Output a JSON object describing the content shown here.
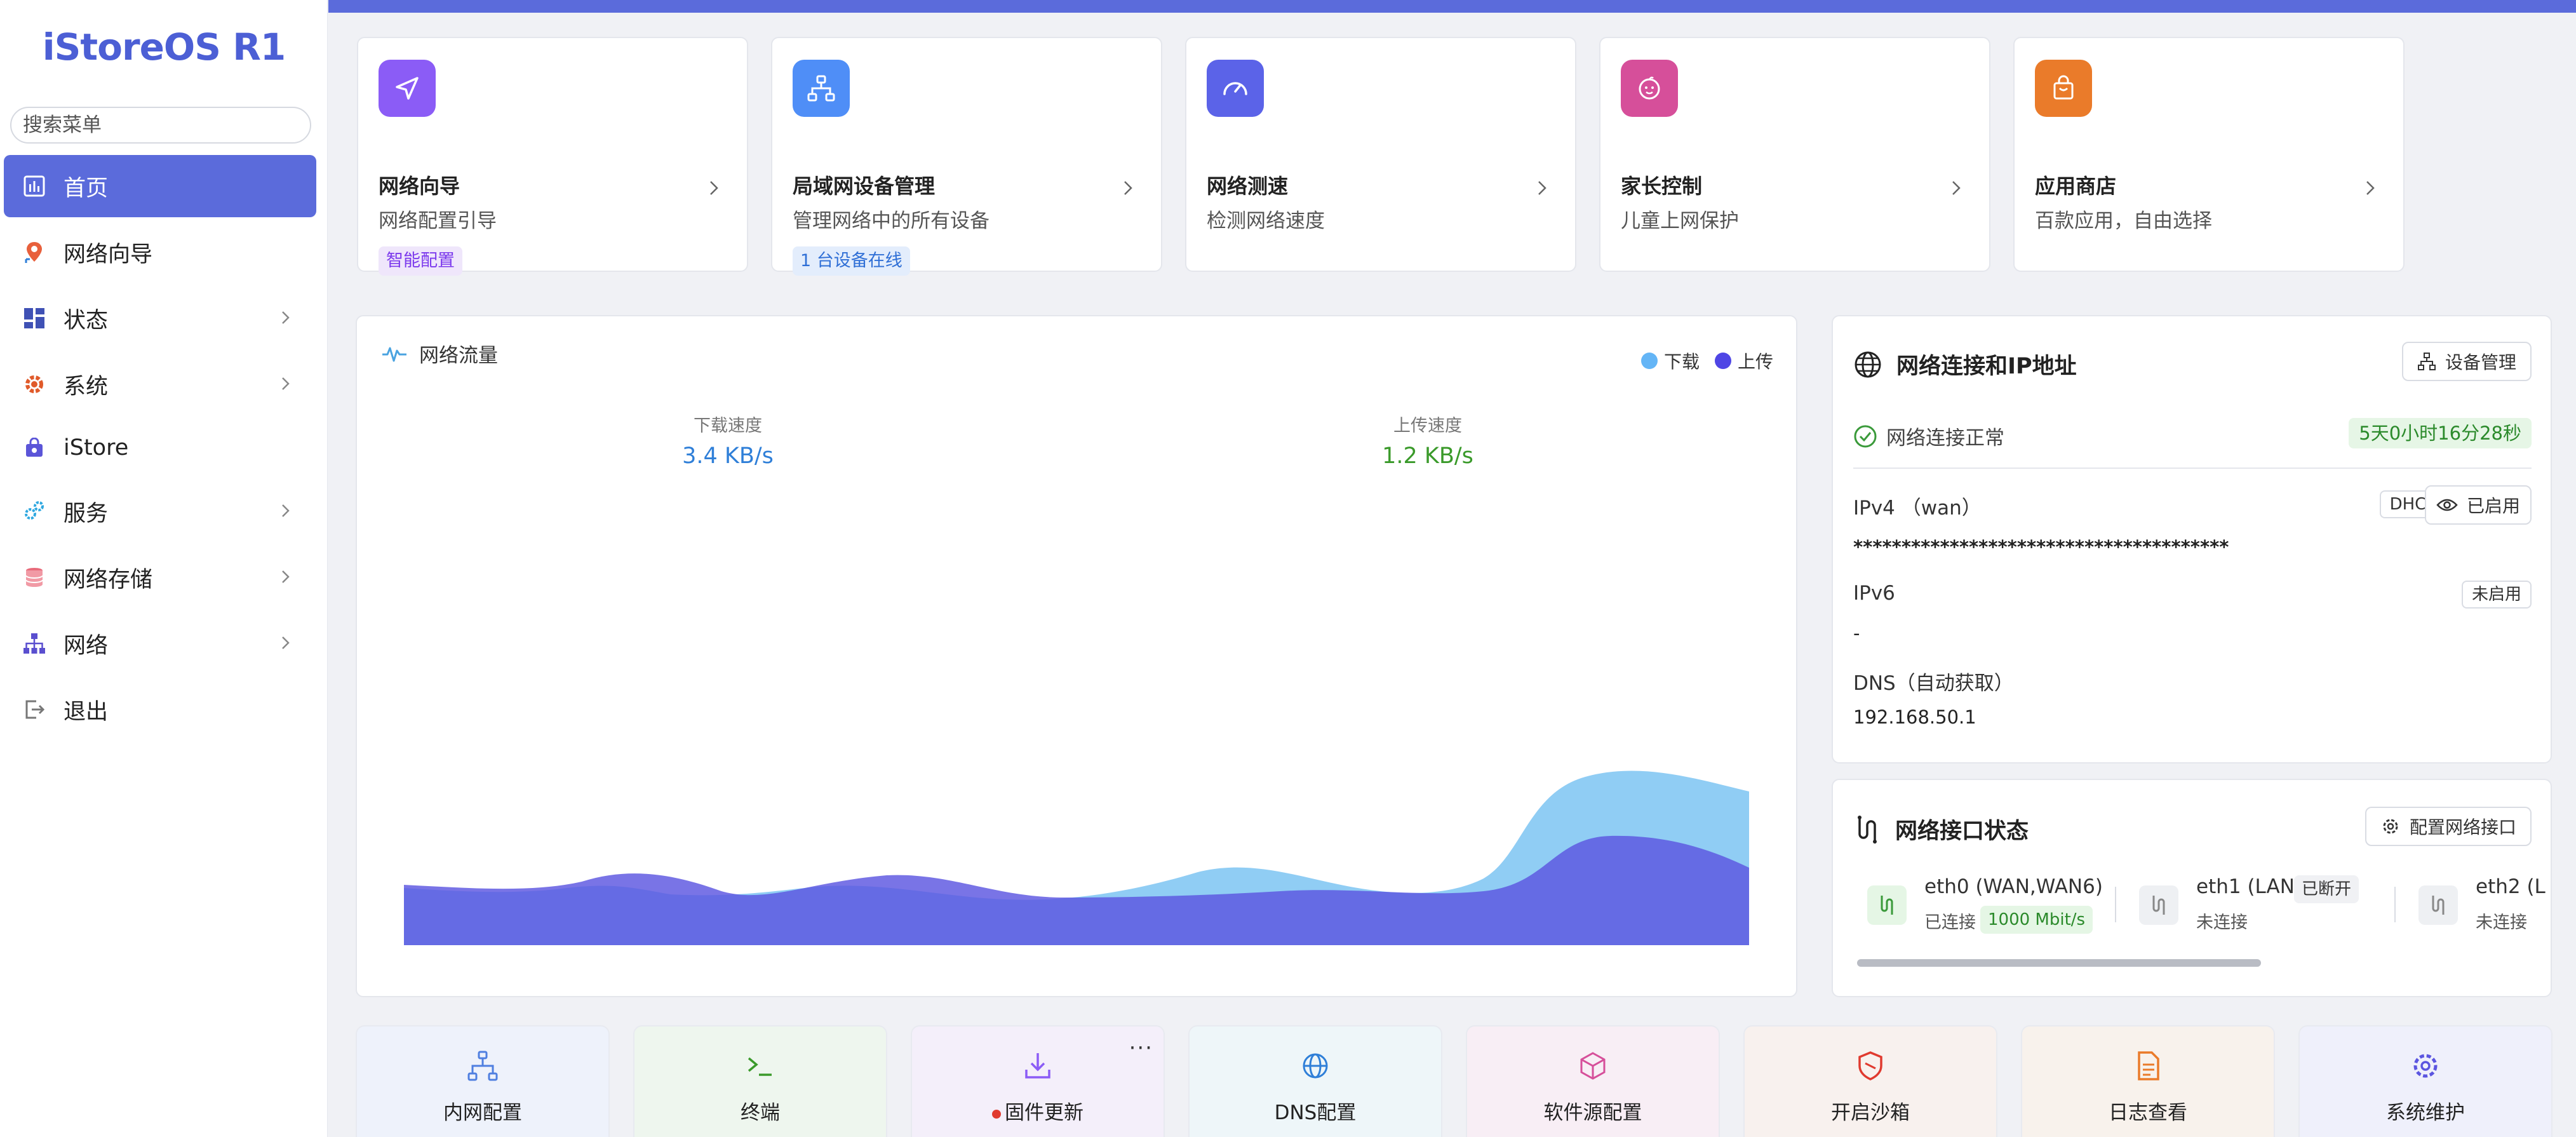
{
  "sidebar": {
    "logo": "iStoreOS R1",
    "search_placeholder": "搜索菜单",
    "items": [
      {
        "label": "首页"
      },
      {
        "label": "网络向导"
      },
      {
        "label": "状态"
      },
      {
        "label": "系统"
      },
      {
        "label": "iStore"
      },
      {
        "label": "服务"
      },
      {
        "label": "网络存储"
      },
      {
        "label": "网络"
      },
      {
        "label": "退出"
      }
    ]
  },
  "quick_cards": [
    {
      "title": "网络向导",
      "subtitle": "网络配置引导",
      "badge": "智能配置",
      "icon": "navigation-arrow-icon",
      "color": "#8b5cf6"
    },
    {
      "title": "局域网设备管理",
      "subtitle": "管理网络中的所有设备",
      "badge": "1 台设备在线",
      "icon": "network-tree-icon",
      "color": "#4f8ef7"
    },
    {
      "title": "网络测速",
      "subtitle": "检测网络速度",
      "icon": "speedometer-icon",
      "color": "#5b63e8"
    },
    {
      "title": "家长控制",
      "subtitle": "儿童上网保护",
      "icon": "child-face-icon",
      "color": "#d64f9a"
    },
    {
      "title": "应用商店",
      "subtitle": "百款应用，自由选择",
      "icon": "shopping-bag-icon",
      "color": "#ea7b2a"
    }
  ],
  "traffic": {
    "title": "网络流量",
    "legend_download": "下载",
    "legend_upload": "上传",
    "download_label": "下载速度",
    "download_value": "3.4 KB/s",
    "upload_label": "上传速度",
    "upload_value": "1.2 KB/s",
    "download_color": "#64b5f6",
    "upload_color": "#4f46e5"
  },
  "connection": {
    "title": "网络连接和IP地址",
    "device_mgmt_button": "设备管理",
    "status_text": "网络连接正常",
    "uptime": "5天0小时16分28秒",
    "ipv4_label": "IPv4 （wan）",
    "ipv4_mode": "DHCP",
    "ipv4_toggle": "已启用",
    "ipv4_value": "***************************************",
    "ipv6_label": "IPv6",
    "ipv6_state": "未启用",
    "ipv6_value": "-",
    "dns_label": "DNS（自动获取）",
    "dns_value": "192.168.50.1"
  },
  "interfaces": {
    "title": "网络接口状态",
    "config_button": "配置网络接口",
    "ports": [
      {
        "name": "eth0 (WAN,WAN6)",
        "status": "已连接",
        "badge": "1000 Mbit/s"
      },
      {
        "name": "eth1 (LAN)",
        "status": "未连接",
        "badge": "已断开"
      },
      {
        "name": "eth2 (L",
        "status": "未连接"
      }
    ]
  },
  "tiles": [
    {
      "label": "内网配置",
      "icon": "lan-tree-icon",
      "bg": "#eef2fb"
    },
    {
      "label": "终端",
      "icon": "terminal-icon",
      "bg": "#eef6ee"
    },
    {
      "label": "固件更新",
      "icon": "download-icon",
      "bg": "#f4effa",
      "more": "···"
    },
    {
      "label": "DNS配置",
      "icon": "globe-icon",
      "bg": "#eef6f9"
    },
    {
      "label": "软件源配置",
      "icon": "package-icon",
      "bg": "#f8eef5"
    },
    {
      "label": "开启沙箱",
      "icon": "shield-icon",
      "bg": "#f8f1ee"
    },
    {
      "label": "日志查看",
      "icon": "document-icon",
      "bg": "#f8f2ec"
    },
    {
      "label": "系统维护",
      "icon": "gear-icon",
      "bg": "#eff0fb"
    }
  ]
}
